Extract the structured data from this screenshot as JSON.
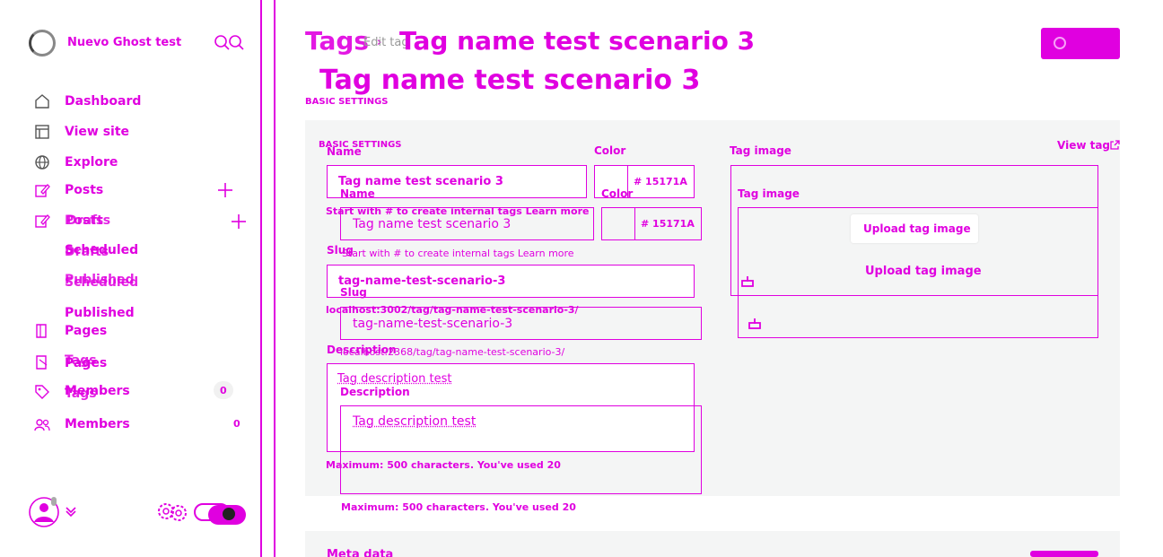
{
  "site": {
    "name": "Nuevo Ghost test"
  },
  "sidebar": {
    "items": [
      {
        "label": "Dashboard",
        "icon": "home-icon"
      },
      {
        "label": "View site",
        "icon": "browser-icon"
      },
      {
        "label": "Explore",
        "icon": "globe-icon"
      },
      {
        "label": "Posts",
        "icon": "pencil-icon"
      },
      {
        "label": "Posts",
        "icon": "pencil-icon"
      },
      {
        "label": "Drafts"
      },
      {
        "label": "Scheduled"
      },
      {
        "label": "Drafts"
      },
      {
        "label": "Published"
      },
      {
        "label": "Scheduled"
      },
      {
        "label": "Published"
      },
      {
        "label": "Pages",
        "icon": "page-icon"
      },
      {
        "label": "Pages",
        "icon": "page-icon"
      },
      {
        "label": "Tags",
        "icon": "tag-icon"
      },
      {
        "label": "Members",
        "icon": "members-icon"
      },
      {
        "label": "Tags"
      },
      {
        "label": "Members",
        "icon": "members-icon"
      }
    ],
    "members_count_1": "0",
    "members_count_2": "0"
  },
  "header": {
    "breadcrumb_tags": "Tags",
    "breadcrumb_arrow": "›",
    "breadcrumb_edit": "Edit tag",
    "title": "Tag name test scenario 3",
    "title_dup": "Tag name test scenario 3"
  },
  "sections": {
    "basic_settings": "BASIC SETTINGS",
    "basic_settings_dup": "BASIC SETTINGS",
    "meta_data": "Meta data"
  },
  "form": {
    "name_label": "Name",
    "name_label_dup": "Name",
    "name_value": "Tag name test scenario 3",
    "name_value_dup": "Tag name test scenario 3",
    "name_hint": "Start with # to create internal tags Learn more",
    "name_hint_dup": "Start with # to create internal tags Learn more",
    "color_label": "Color",
    "color_label_dup": "Color",
    "color_value": "# 15171A",
    "color_value_dup": "# 15171A",
    "slug_label": "Slug",
    "slug_label_dup": "Slug",
    "slug_value": "tag-name-test-scenario-3",
    "slug_value_dup": "tag-name-test-scenario-3",
    "slug_url": "localhost:3002/tag/tag-name-test-scenario-3/",
    "slug_url_dup": "localhost:2368/tag/tag-name-test-scenario-3/",
    "description_label": "Description",
    "description_label_dup": "Description",
    "description_value": "Tag description test",
    "description_value_dup": "Tag description test",
    "description_hint": "Maximum: 500 characters. You've used 20",
    "description_hint_dup": "Maximum: 500 characters. You've used 20",
    "image_label": "Tag image",
    "image_label_dup": "Tag image",
    "upload_label": "Upload tag image",
    "upload_label_dup": "Upload tag image",
    "view_tag": "View tag"
  },
  "colors": {
    "accent": "#e000e0",
    "panel": "#f4f5f5"
  }
}
